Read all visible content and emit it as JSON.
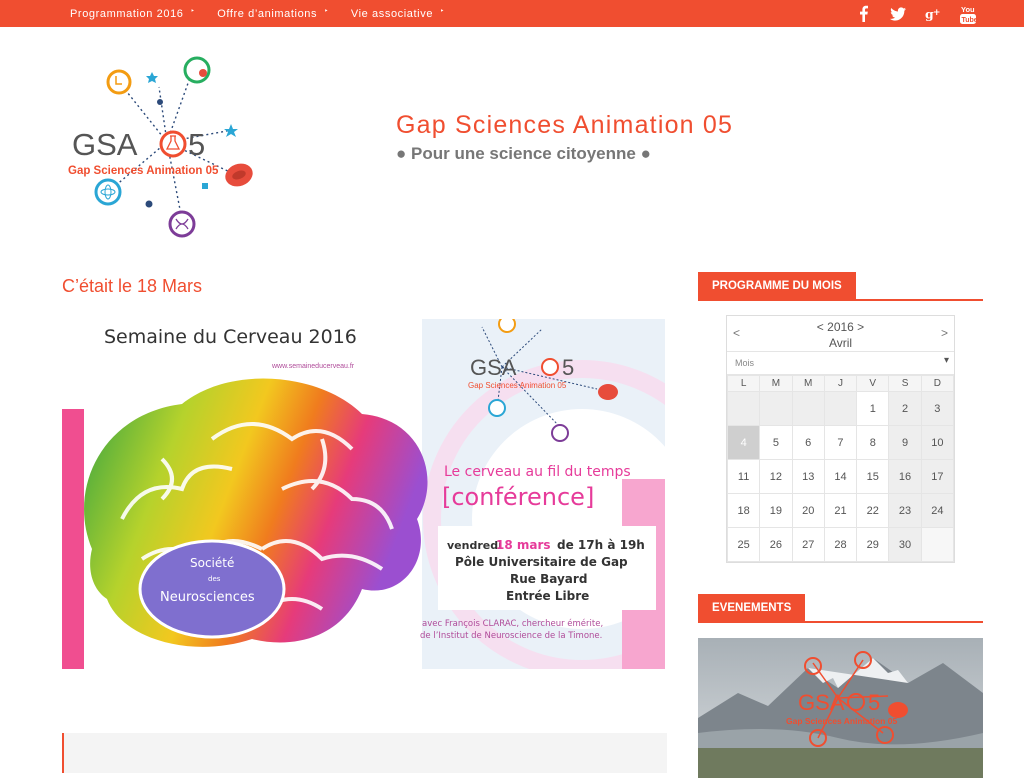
{
  "topnav": {
    "items": [
      {
        "label": "Programmation 2016"
      },
      {
        "label": "Offre d’animations"
      },
      {
        "label": "Vie associative"
      }
    ],
    "caret": "‣"
  },
  "social": {
    "icons": [
      "facebook-icon",
      "twitter-icon",
      "google-plus-icon",
      "youtube-icon"
    ],
    "youtube_text": "You Tube"
  },
  "logo": {
    "text_main": "GSA",
    "text_num": "5",
    "text_sub": "Gap Sciences Animation 05"
  },
  "header": {
    "title": "Gap Sciences Animation 05",
    "tagline": "● Pour une science citoyenne ●"
  },
  "post": {
    "title": "C’était le 18 Mars",
    "poster": {
      "heading": "Semaine du Cerveau 2016",
      "url": "www.semaineducerveau.fr",
      "subtitle": "Le cerveau au fil du temps",
      "kind": "[conférence]",
      "date_prefix": "vendredi",
      "date": "18 mars",
      "time": "de 17h à 19h",
      "place1": "Pôle Universitaire de Gap",
      "place2": "Rue Bayard",
      "entry": "Entrée Libre",
      "speaker1": "avec François CLARAC, chercheur émérite,",
      "speaker2": "de l’Institut de Neuroscience de la Timone.",
      "society1": "Société",
      "society2": "des",
      "society3": "Neurosciences",
      "logo_main": "GSA",
      "logo_num": "5",
      "logo_sub": "Gap Sciences Animation 05"
    }
  },
  "sidebar": {
    "programme_title": "PROGRAMME DU MOIS",
    "events_title": "EVENEMENTS",
    "events_logo_main": "GSA",
    "events_logo_num": "5",
    "events_logo_sub": "Gap Sciences Animation 05"
  },
  "calendar": {
    "prev": "<",
    "next": ">",
    "year_nav": "< 2016 >",
    "month": "Avril",
    "select_placeholder": "Mois",
    "weekdays": [
      "L",
      "M",
      "M",
      "J",
      "V",
      "S",
      "D"
    ],
    "weeks": [
      [
        "",
        "",
        "",
        "",
        "1",
        "2",
        "3"
      ],
      [
        "4",
        "5",
        "6",
        "7",
        "8",
        "9",
        "10"
      ],
      [
        "11",
        "12",
        "13",
        "14",
        "15",
        "16",
        "17"
      ],
      [
        "18",
        "19",
        "20",
        "21",
        "22",
        "23",
        "24"
      ],
      [
        "25",
        "26",
        "27",
        "28",
        "29",
        "30",
        ""
      ]
    ],
    "today": "4"
  },
  "colors": {
    "accent": "#f04e30",
    "tagline": "#777777",
    "logo_orange": "#f39c12",
    "logo_green": "#27ae60",
    "logo_blue": "#2aa6d5",
    "logo_purple": "#7d3c98",
    "logo_red": "#e74c3c",
    "logo_navy": "#2c4a7a"
  }
}
